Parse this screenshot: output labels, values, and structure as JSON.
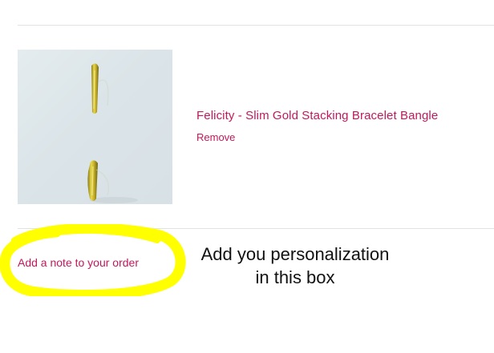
{
  "cart_item": {
    "title": "Felicity - Slim Gold Stacking Bracelet Bangle",
    "remove_label": "Remove",
    "image_icon": "bracelet-product-photo"
  },
  "order_note": {
    "link_label": "Add a note to your order",
    "highlight_color": "#ffff00"
  },
  "annotation": {
    "line1": "Add you personalization",
    "line2": "in this box"
  },
  "colors": {
    "accent": "#c2185b",
    "divider": "#e2e2e2",
    "highlight": "#ffff00"
  }
}
